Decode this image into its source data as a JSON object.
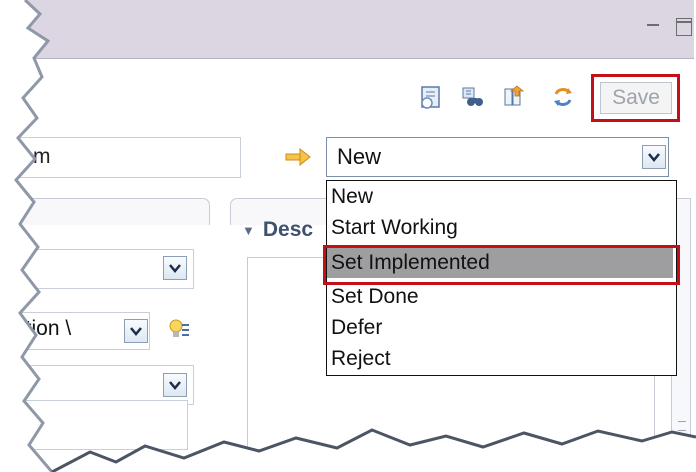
{
  "toolbar": {
    "save_label": "Save",
    "icons": [
      "record-icon",
      "binoculars-icon",
      "workflow-icon",
      "refresh-icon"
    ]
  },
  "summary": {
    "value": "m"
  },
  "state": {
    "selected": "New",
    "options": [
      "New",
      "Start Working",
      "Set Implemented",
      "Set Done",
      "Defer",
      "Reject"
    ],
    "highlighted": "Set Implemented"
  },
  "sections": {
    "description_title": "Desc"
  },
  "left_panel": {
    "iteration_value": "ration \\"
  },
  "colors": {
    "accent_highlight": "#c40f16",
    "section_title": "#3e526f",
    "selected_item": "#9e9ea0"
  }
}
